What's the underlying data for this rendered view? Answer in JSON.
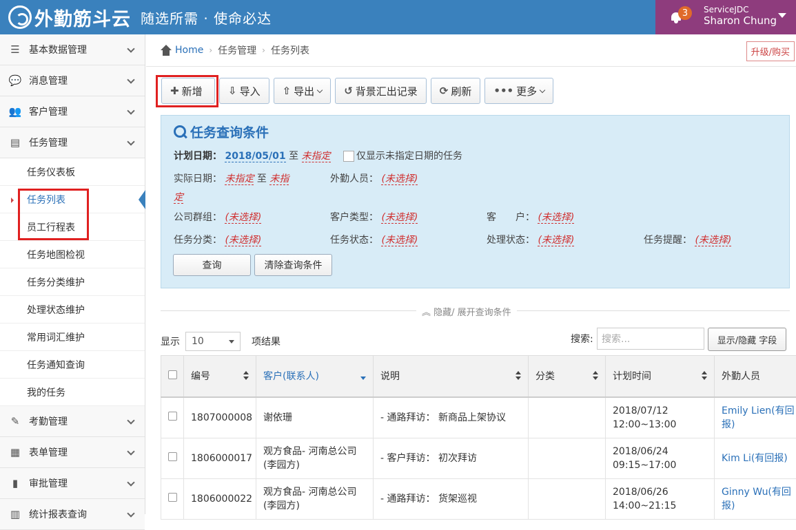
{
  "header": {
    "logo_text": "外勤筋斗云",
    "slogan": "随选所需 · 使命必达",
    "notif_count": "3",
    "company": "ServiceJDC",
    "user_name": "Sharon Chung"
  },
  "sidebar": {
    "groups": [
      {
        "label": "基本数据管理",
        "icon": "list-icon"
      },
      {
        "label": "消息管理",
        "icon": "chat-icon"
      },
      {
        "label": "客户管理",
        "icon": "users-icon"
      },
      {
        "label": "任务管理",
        "icon": "tasks-icon"
      }
    ],
    "sub_items": [
      "任务仪表板",
      "任务列表",
      "员工行程表",
      "任务地图检视",
      "任务分类维护",
      "处理状态维护",
      "常用词汇维护",
      "任务通知查询",
      "我的任务"
    ],
    "bottom_groups": [
      {
        "label": "考勤管理",
        "icon": "edit-icon"
      },
      {
        "label": "表单管理",
        "icon": "doc-icon"
      },
      {
        "label": "审批管理",
        "icon": "file-icon"
      },
      {
        "label": "统计报表查询",
        "icon": "chart-icon"
      }
    ]
  },
  "breadcrumb": {
    "home": "Home",
    "level1": "任务管理",
    "level2": "任务列表",
    "upgrade": "升级/购买"
  },
  "toolbar": {
    "add": "新增",
    "import": "导入",
    "export": "导出",
    "bg_export": "背景汇出记录",
    "refresh": "刷新",
    "more": "更多"
  },
  "query": {
    "title": "任务查询条件",
    "plan_date_label": "计划日期：",
    "plan_date_from": "2018/05/01",
    "to": "至",
    "unspecified": "未指定",
    "only_unspecified": "仅显示未指定日期的任务",
    "actual_date_label": "实际日期：",
    "actual_to_a": "未指",
    "actual_to_b": "定",
    "staff_label": "外勤人员：",
    "unselected": "(未选择)",
    "company_group_label": "公司群组：",
    "customer_type_label": "客户类型：",
    "customer_label": "客　　户：",
    "task_category_label": "任务分类：",
    "task_status_label": "任务状态：",
    "process_status_label": "处理状态：",
    "task_reminder_label": "任务提醒：",
    "search_btn": "查询",
    "clear_btn": "清除查询条件"
  },
  "toggle_label": "隐藏/ 展开查询条件",
  "list": {
    "show_label": "显示",
    "page_size": "10",
    "items_label": "项结果",
    "search_label": "搜索:",
    "search_placeholder": "搜索...",
    "fields_btn": "显示/隐藏 字段"
  },
  "table": {
    "headers": [
      "编号",
      "客户(联系人)",
      "说明",
      "分类",
      "计划时间",
      "外勤人员"
    ],
    "rows": [
      {
        "id": "1807000008",
        "customer_a": "谢依珊",
        "customer_b": "",
        "desc": "- 通路拜访： 新商品上架协议",
        "category": "",
        "time_a": "2018/07/12",
        "time_b": "12:00~13:00",
        "staff_a": "Emily Lien(有回",
        "staff_b": "报)"
      },
      {
        "id": "1806000017",
        "customer_a": "观方食品- 河南总公司",
        "customer_b": "(李园方)",
        "desc": "- 客户拜访： 初次拜访",
        "category": "",
        "time_a": "2018/06/24",
        "time_b": "09:15~17:00",
        "staff_a": "Kim Li(有回报)",
        "staff_b": ""
      },
      {
        "id": "1806000022",
        "customer_a": "观方食品- 河南总公司",
        "customer_b": "(李园方)",
        "desc": "- 通路拜访： 货架巡视",
        "category": "",
        "time_a": "2018/06/26",
        "time_b": "14:00~21:15",
        "staff_a": "Ginny Wu(有回",
        "staff_b": "报)"
      }
    ]
  },
  "colors": {
    "topbar": "#3a81bd",
    "user_area": "#8e3c7d",
    "accent": "#2a70b8",
    "highlight_box": "#e02020"
  }
}
